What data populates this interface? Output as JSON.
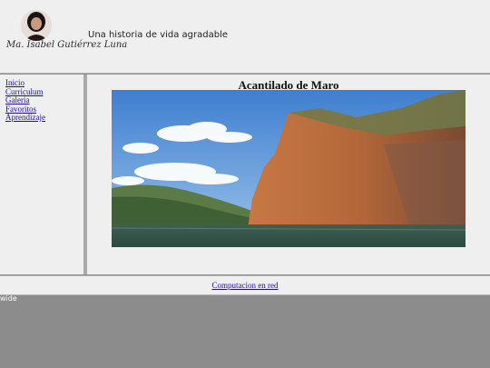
{
  "header": {
    "signature": "Ma. Isabel Gutiérrez Luna",
    "tagline": "Una historia de vida agradable"
  },
  "sidebar": {
    "items": [
      {
        "label": "Inicio"
      },
      {
        "label": "Curriculum"
      },
      {
        "label": "Galeria"
      },
      {
        "label": "Favoritos"
      },
      {
        "label": "Aprendizaje"
      }
    ]
  },
  "main": {
    "title": "Acantilado de Maro"
  },
  "footer": {
    "link": "Computacion en red"
  },
  "bottom_note": "wide",
  "colors": {
    "link": "#1a0dab",
    "panel": "#efefef",
    "background": "#8c8c8c"
  }
}
